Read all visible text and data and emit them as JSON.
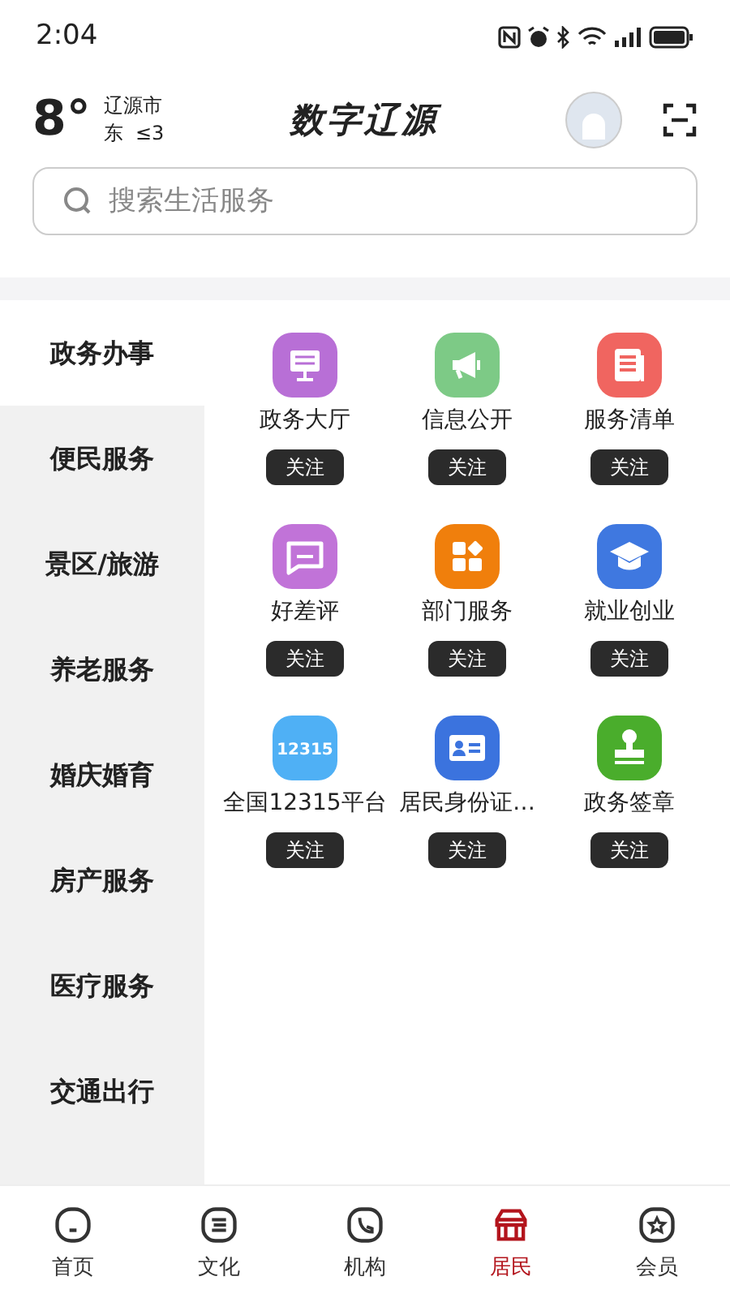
{
  "status_bar": {
    "time": "2:04"
  },
  "header": {
    "temperature": "8°",
    "city": "辽源市",
    "wind": "东  ≤3",
    "title": "数字辽源"
  },
  "search": {
    "placeholder": "搜索生活服务"
  },
  "sidebar": {
    "items": [
      {
        "label": "政务办事",
        "selected": true
      },
      {
        "label": "便民服务",
        "selected": false
      },
      {
        "label": "景区/旅游",
        "selected": false
      },
      {
        "label": "养老服务",
        "selected": false
      },
      {
        "label": "婚庆婚育",
        "selected": false
      },
      {
        "label": "房产服务",
        "selected": false
      },
      {
        "label": "医疗服务",
        "selected": false
      },
      {
        "label": "交通出行",
        "selected": false
      }
    ]
  },
  "services": [
    {
      "label": "政务大厅",
      "color": "#b86fd6",
      "button": "关注"
    },
    {
      "label": "信息公开",
      "color": "#7dca86",
      "button": "关注"
    },
    {
      "label": "服务清单",
      "color": "#f06560",
      "button": "关注"
    },
    {
      "label": "好差评",
      "color": "#c173d8",
      "button": "关注"
    },
    {
      "label": "部门服务",
      "color": "#f07f0c",
      "button": "关注"
    },
    {
      "label": "就业创业",
      "color": "#3f78e0",
      "button": "关注"
    },
    {
      "label": "全国12315平台",
      "color": "#4fb0f5",
      "button": "关注",
      "icon_text": "12315"
    },
    {
      "label": "居民身份证…",
      "color": "#3b73de",
      "button": "关注"
    },
    {
      "label": "政务签章",
      "color": "#4aad2c",
      "button": "关注"
    }
  ],
  "bottom_nav": [
    {
      "label": "首页",
      "selected": false
    },
    {
      "label": "文化",
      "selected": false
    },
    {
      "label": "机构",
      "selected": false
    },
    {
      "label": "居民",
      "selected": true
    },
    {
      "label": "会员",
      "selected": false
    }
  ]
}
